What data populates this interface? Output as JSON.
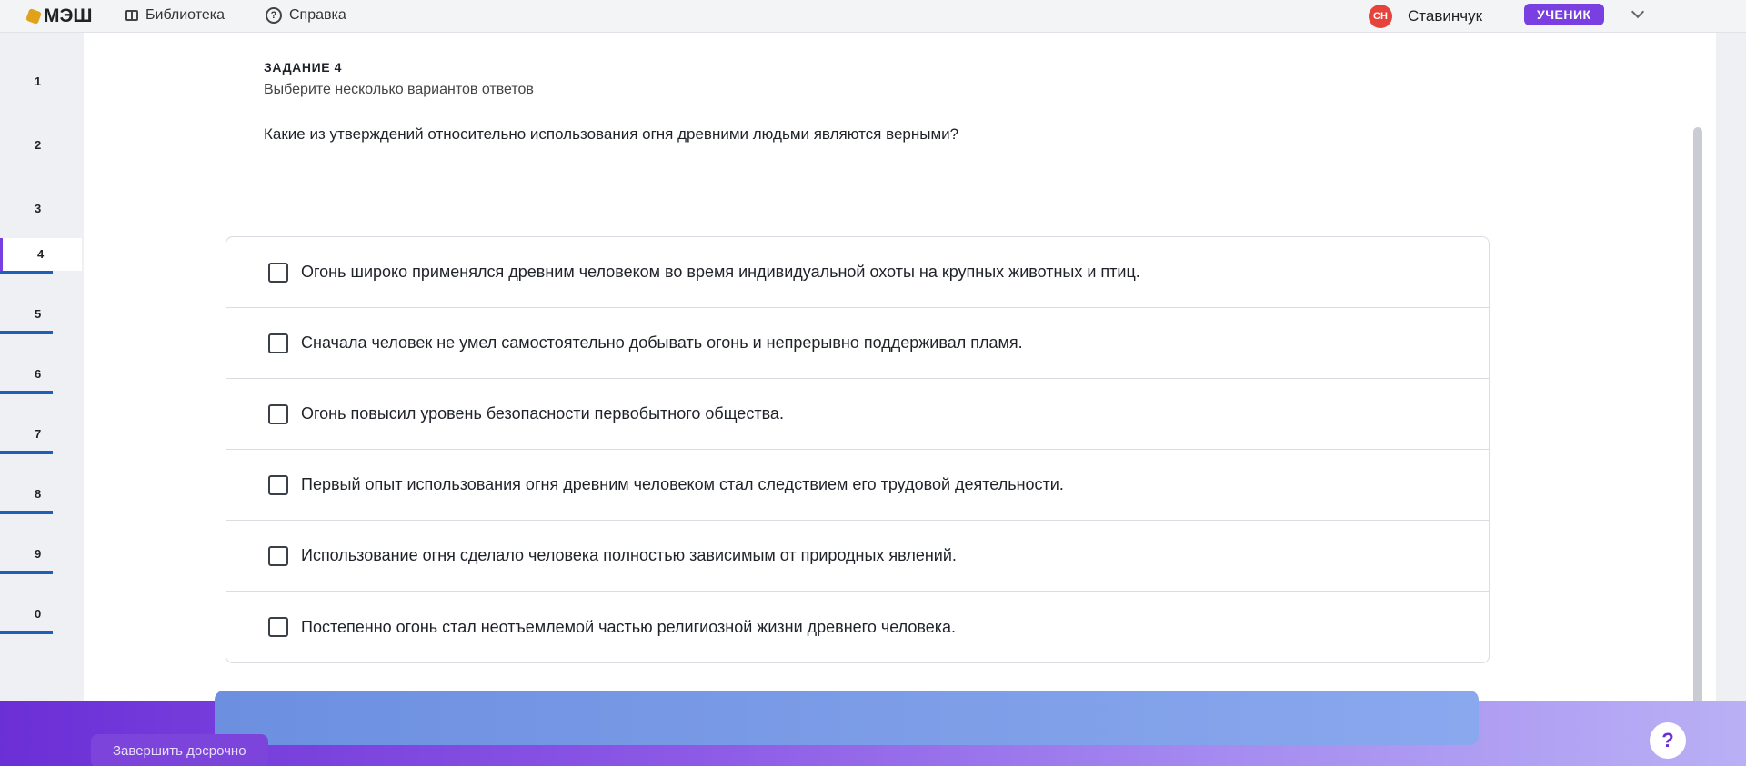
{
  "topbar": {
    "logo_text": "МЭШ",
    "library_label": "Библиотека",
    "help_label": "Справка",
    "user_initials": "СН",
    "user_name": "Ставинчук",
    "role_label": "УЧЕНИК"
  },
  "task_nav": {
    "items": [
      "1",
      "2",
      "3",
      "4",
      "5",
      "6",
      "7",
      "8",
      "9",
      "0"
    ],
    "active": "4"
  },
  "task": {
    "label": "ЗАДАНИЕ 4",
    "hint": "Выберите несколько вариантов ответов",
    "question": "Какие из утверждений относительно использования огня древними людьми являются верными?",
    "options": [
      "Огонь широко применялся древним человеком во время индивидуальной охоты на крупных животных и птиц.",
      "Сначала человек не умел самостоятельно добывать огонь и непрерывно поддерживал пламя.",
      "Огонь повысил уровень безопасности первобытного общества.",
      "Первый опыт использования огня древним человеком стал следствием его трудовой деятельности.",
      "Использование огня сделало человека полностью зависимым от природных явлений.",
      "Постепенно огонь стал неотъемлемой частью религиозной жизни древнего человека."
    ]
  },
  "footer": {
    "finish_early_label": "Завершить досрочно",
    "help_symbol": "?"
  },
  "colors": {
    "accent": "#7a3fe0",
    "brand_red": "#e5433b",
    "nav_bar": "#1e5fb8"
  }
}
